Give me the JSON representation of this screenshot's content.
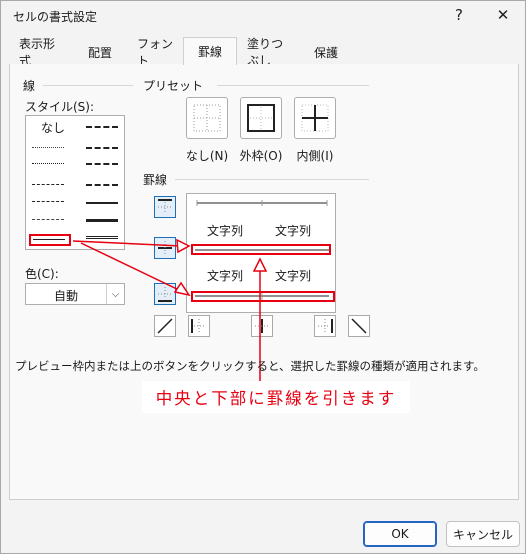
{
  "window": {
    "title": "セルの書式設定",
    "help_glyph": "?",
    "close_glyph": "✕"
  },
  "tabs": [
    {
      "label": "表示形式"
    },
    {
      "label": "配置"
    },
    {
      "label": "フォント"
    },
    {
      "label": "罫線",
      "active": true
    },
    {
      "label": "塗りつぶし"
    },
    {
      "label": "保護"
    }
  ],
  "line_group": {
    "title": "線",
    "style_label": "スタイル(S):",
    "none_style": "なし",
    "color_label": "色(C):",
    "color_value": "自動",
    "selected_style": "thin-solid"
  },
  "presets": {
    "title": "プリセット",
    "none": "なし(N)",
    "outline": "外枠(O)",
    "inside": "内側(I)"
  },
  "border": {
    "title": "罫線",
    "preview_text": "文字列"
  },
  "description": "プレビュー枠内または上のボタンをクリックすると、選択した罫線の種類が適用されます。",
  "annotation": "中央と下部に罫線を引きます",
  "buttons": {
    "ok": "OK",
    "cancel": "キャンセル"
  },
  "colors": {
    "highlight": "#e60012",
    "accent": "#2563c5"
  }
}
